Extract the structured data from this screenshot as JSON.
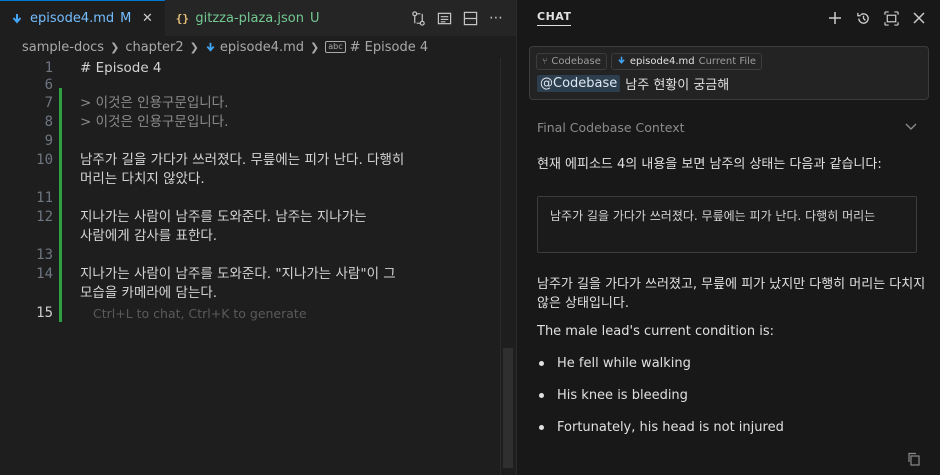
{
  "tabs": [
    {
      "name": "episode4.md",
      "status": "M",
      "icon": "markdown-icon",
      "active": true
    },
    {
      "name": "gitzza-plaza.json",
      "status": "U",
      "icon": "json-icon",
      "icon_text": "{}",
      "active": false
    }
  ],
  "breadcrumb": {
    "items": [
      "sample-docs",
      "chapter2",
      "episode4.md",
      "# Episode 4"
    ],
    "symbol_badge": "abc"
  },
  "editor": {
    "lines": [
      {
        "num": "1",
        "text": "# Episode 4",
        "kind": "heading"
      },
      {
        "num": "6",
        "text": "",
        "kind": "blank"
      },
      {
        "num": "7",
        "text": "> 이것은 인용구문입니다.",
        "kind": "quote"
      },
      {
        "num": "8",
        "text": "> 이것은 인용구문입니다.",
        "kind": "quote"
      },
      {
        "num": "9",
        "text": "",
        "kind": "blank"
      },
      {
        "num": "10",
        "text": "남주가 길을 가다가 쓰러졌다. 무릎에는 피가 난다. 다행히",
        "kind": "text"
      },
      {
        "num": "",
        "text": "머리는 다치지 않았다.",
        "kind": "wrap"
      },
      {
        "num": "11",
        "text": "",
        "kind": "blank"
      },
      {
        "num": "12",
        "text": "지나가는 사람이 남주를 도와준다. 남주는 지나가는",
        "kind": "text"
      },
      {
        "num": "",
        "text": "사람에게 감사를 표한다.",
        "kind": "wrap"
      },
      {
        "num": "13",
        "text": "",
        "kind": "blank"
      },
      {
        "num": "14",
        "text": "지나가는 사람이 남주를 도와준다. \"지나가는 사람\"이 그",
        "kind": "text"
      },
      {
        "num": "",
        "text": "모습을 카메라에 담는다.",
        "kind": "wrap"
      },
      {
        "num": "15",
        "text": "Ctrl+L to chat, Ctrl+K to generate",
        "kind": "hint"
      }
    ],
    "accent": "#2ea043"
  },
  "chat": {
    "title": "CHAT",
    "context_chips": [
      {
        "icon": "branch-icon",
        "name": "Codebase",
        "sub": ""
      },
      {
        "icon": "markdown-icon",
        "name": "episode4.md",
        "sub": "Current File"
      }
    ],
    "mention": "@Codebase",
    "query": "남주 현황이 궁금해",
    "context_label": "Final Codebase Context",
    "intro": "현재 에피소드 4의 내용을 보면 남주의 상태는 다음과 같습니다:",
    "quote": "남주가 길을 가다가 쓰러졌다. 무릎에는 피가 난다. 다행히 머리는",
    "summary": "남주가 길을 가다가 쓰러졌고, 무릎에 피가 났지만 다행히 머리는 다치지 않은 상태입니다.",
    "english_intro": "The male lead's current condition is:",
    "bullets": [
      "He fell while walking",
      "His knee is bleeding",
      "Fortunately, his head is not injured"
    ]
  },
  "colors": {
    "active_tab_text": "#75beff",
    "untracked_tab_text": "#73c991",
    "mention_bg": "#2d3e4f"
  }
}
